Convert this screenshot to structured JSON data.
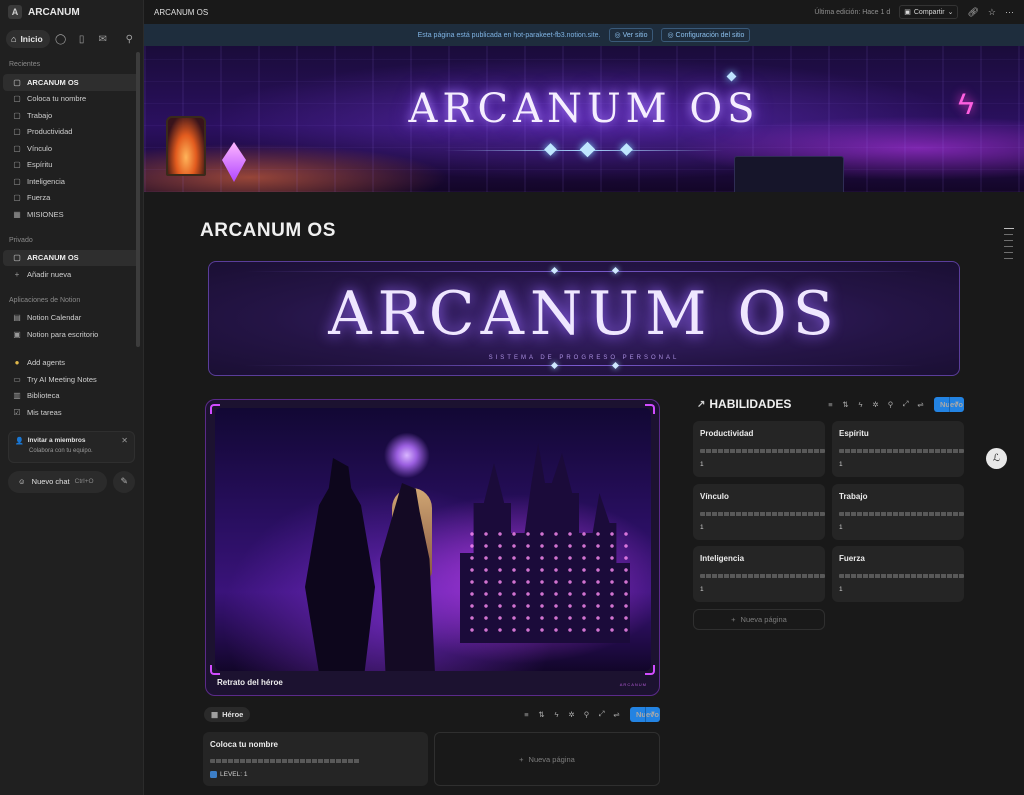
{
  "workspace": {
    "initial": "A",
    "name": "ARCANUM"
  },
  "sidebar": {
    "home_label": "Inicio",
    "recents_label": "Recientes",
    "recents": [
      "ARCANUM OS",
      "Coloca tu nombre",
      "Trabajo",
      "Productividad",
      "Vínculo",
      "Espíritu",
      "Inteligencia",
      "Fuerza",
      "MISIONES"
    ],
    "private_label": "Privado",
    "private": [
      "ARCANUM OS"
    ],
    "add_new_label": "Añadir nueva",
    "apps_label": "Aplicaciones de Notion",
    "apps": [
      "Notion Calendar",
      "Notion para escritorio"
    ],
    "extras": [
      "Add agents",
      "Try AI Meeting Notes",
      "Biblioteca",
      "Mis tareas"
    ],
    "invite_title": "Invitar a miembros",
    "invite_subtitle": "Colabora con tu equipo.",
    "new_chat_label": "Nuevo chat",
    "new_chat_shortcut": "Ctrl+O"
  },
  "topbar": {
    "breadcrumb": "ARCANUM OS",
    "last_edited": "Última edición: Hace 1 d",
    "share_label": "Compartir"
  },
  "banner": {
    "text": "Esta página está publicada en hot-parakeet-fb3.notion.site.",
    "view_site": "Ver sitio",
    "site_settings": "Configuración del sitio"
  },
  "cover": {
    "title": "ARCANUM OS"
  },
  "page": {
    "title": "ARCANUM OS",
    "hero_banner_title": "ARCANUM OS",
    "hero_banner_subtitle": "SISTEMA DE PROGRESO PERSONAL"
  },
  "portrait": {
    "caption": "Retrato del héroe",
    "watermark": "ARCANUM"
  },
  "hero_db": {
    "view_label": "Héroe",
    "new_label": "Nuevo",
    "card_title": "Coloca tu nombre",
    "card_badge": "LEVEL: 1",
    "new_page_label": "Nueva página"
  },
  "skills": {
    "title": "HABILIDADES",
    "new_label": "Nuevo",
    "items": [
      {
        "name": "Productividad",
        "value": "1"
      },
      {
        "name": "Espíritu",
        "value": "1"
      },
      {
        "name": "Vínculo",
        "value": "1"
      },
      {
        "name": "Trabajo",
        "value": "1"
      },
      {
        "name": "Inteligencia",
        "value": "1"
      },
      {
        "name": "Fuerza",
        "value": "1"
      }
    ],
    "new_page_label": "Nueva página"
  },
  "colors": {
    "accent": "#2383e2",
    "banner_bg": "#1e2d3d",
    "purple_glow": "#9a6bff",
    "sidebar_bg": "#202020",
    "page_bg": "#191919"
  }
}
